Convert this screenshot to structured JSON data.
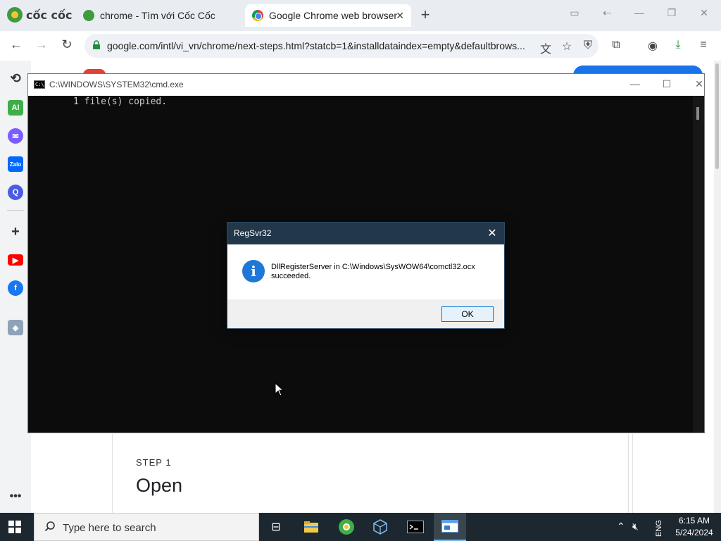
{
  "browser": {
    "brand": "cốc cốc",
    "tabs": [
      {
        "title": "chrome - Tìm với Cốc Cốc",
        "active": false,
        "icon": "coccoc-favicon"
      },
      {
        "title": "Google Chrome web browser",
        "active": true,
        "icon": "chrome-favicon"
      }
    ],
    "url": "google.com/intl/vi_vn/chrome/next-steps.html?statcb=1&installdataindex=empty&defaultbrows..."
  },
  "page": {
    "step_label": "STEP 1",
    "step_title": "Open"
  },
  "cmd": {
    "title": "C:\\WINDOWS\\SYSTEM32\\cmd.exe",
    "icon_text": "C:\\",
    "output": "1 file(s) copied."
  },
  "dialog": {
    "title": "RegSvr32",
    "message": "DllRegisterServer in C:\\Windows\\SysWOW64\\comctl32.ocx succeeded.",
    "ok_label": "OK"
  },
  "taskbar": {
    "search_placeholder": "Type here to search",
    "language": "ENG",
    "time": "6:15 AM",
    "date": "5/24/2024"
  },
  "colors": {
    "dialog_titlebar": "#22374a",
    "info_blue": "#1e78d7",
    "taskbar": "#1d2730",
    "cmd_bg": "#0c0c0c"
  }
}
